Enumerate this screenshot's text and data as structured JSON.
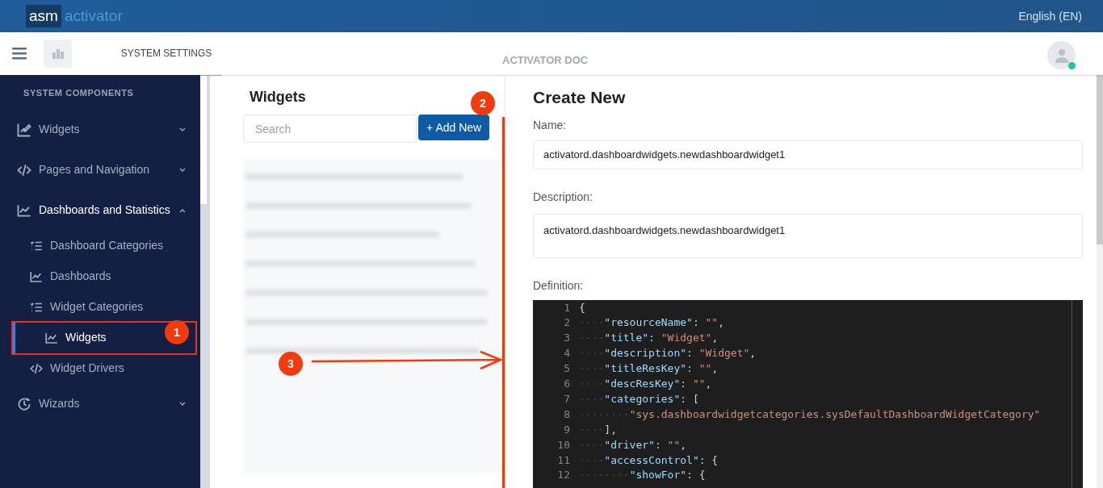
{
  "header": {
    "logo_box": "asm",
    "logo_text": "activator",
    "language": "English (EN)"
  },
  "topbar": {
    "tab": "SYSTEM SETTINGS",
    "title": "ACTIVATOR DOC",
    "user_online": true
  },
  "sidebar": {
    "heading": "SYSTEM COMPONENTS",
    "items": [
      {
        "label": "Widgets",
        "kind": "edit-chart",
        "expanded": false
      },
      {
        "label": "Pages and Navigation",
        "kind": "code",
        "expanded": false
      },
      {
        "label": "Dashboards and Statistics",
        "kind": "chart",
        "expanded": true,
        "children": [
          {
            "label": "Dashboard Categories",
            "kind": "list",
            "selected": false
          },
          {
            "label": "Dashboards",
            "kind": "chart",
            "selected": false
          },
          {
            "label": "Widget Categories",
            "kind": "list",
            "selected": false
          },
          {
            "label": "Widgets",
            "kind": "chart",
            "selected": true
          },
          {
            "label": "Widget Drivers",
            "kind": "code",
            "selected": false
          }
        ]
      },
      {
        "label": "Wizards",
        "kind": "clock",
        "expanded": false
      }
    ]
  },
  "list_panel": {
    "title": "Widgets",
    "search": {
      "placeholder": "Search"
    },
    "add_button": "+ Add New"
  },
  "form": {
    "title": "Create New",
    "name_label": "Name:",
    "name_value": "activatord.dashboardwidgets.newdashboardwidget1",
    "description_label": "Description:",
    "description_value": "activatord.dashboardwidgets.newdashboardwidget1",
    "definition_label": "Definition:",
    "code_lines": [
      {
        "number": "1",
        "text": "{"
      },
      {
        "number": "2",
        "text": "····\"resourceName\": \"\","
      },
      {
        "number": "3",
        "text": "····\"title\": \"Widget\","
      },
      {
        "number": "4",
        "text": "····\"description\": \"Widget\","
      },
      {
        "number": "5",
        "text": "····\"titleResKey\": \"\","
      },
      {
        "number": "6",
        "text": "····\"descResKey\": \"\","
      },
      {
        "number": "7",
        "text": "····\"categories\": ["
      },
      {
        "number": "8",
        "text": "········\"sys.dashboardwidgetcategories.sysDefaultDashboardWidgetCategory\""
      },
      {
        "number": "9",
        "text": "····],"
      },
      {
        "number": "10",
        "text": "····\"driver\": \"\","
      },
      {
        "number": "11",
        "text": "····\"accessControl\": {"
      },
      {
        "number": "12",
        "text": "········\"showFor\": {"
      }
    ]
  },
  "annotations": [
    {
      "number": "1"
    },
    {
      "number": "2"
    },
    {
      "number": "3"
    }
  ]
}
